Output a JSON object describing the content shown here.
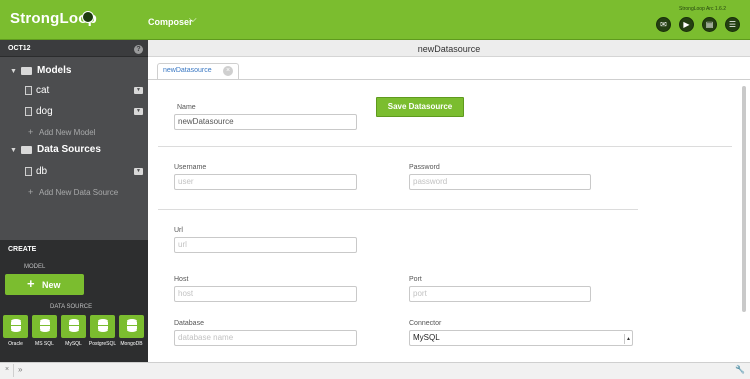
{
  "header": {
    "logo": "StrongLoop",
    "app_menu": "Composer",
    "version": "StrongLoop Arc 1.6.2",
    "icons": [
      "chat-icon",
      "play-icon",
      "document-icon",
      "menu-icon"
    ]
  },
  "sidebar": {
    "project": "OCT12",
    "models_title": "Models",
    "models": [
      "cat",
      "dog"
    ],
    "add_model": "Add New Model",
    "datasources_title": "Data Sources",
    "datasources": [
      "db"
    ],
    "add_datasource": "Add New Data Source"
  },
  "create": {
    "title": "CREATE",
    "model_label": "MODEL",
    "new_label": "New",
    "datasource_label": "DATA SOURCE",
    "connectors": [
      "Oracle",
      "MS SQL",
      "MySQL",
      "PostgreSQL",
      "MongoDB"
    ]
  },
  "main": {
    "title": "newDatasource",
    "tab_label": "newDatasource",
    "save_label": "Save Datasource",
    "form": {
      "name_label": "Name",
      "name_value": "newDatasource",
      "username_label": "Username",
      "username_placeholder": "user",
      "password_label": "Password",
      "password_placeholder": "password",
      "url_label": "Url",
      "url_placeholder": "url",
      "host_label": "Host",
      "host_placeholder": "host",
      "port_label": "Port",
      "port_placeholder": "port",
      "database_label": "Database",
      "database_placeholder": "database name",
      "connector_label": "Connector",
      "connector_value": "MySQL"
    }
  },
  "colors": {
    "accent": "#7bbd2f",
    "sidebar": "#4c4d4f",
    "create_panel": "#2d2e2f",
    "link": "#3a78c3"
  }
}
